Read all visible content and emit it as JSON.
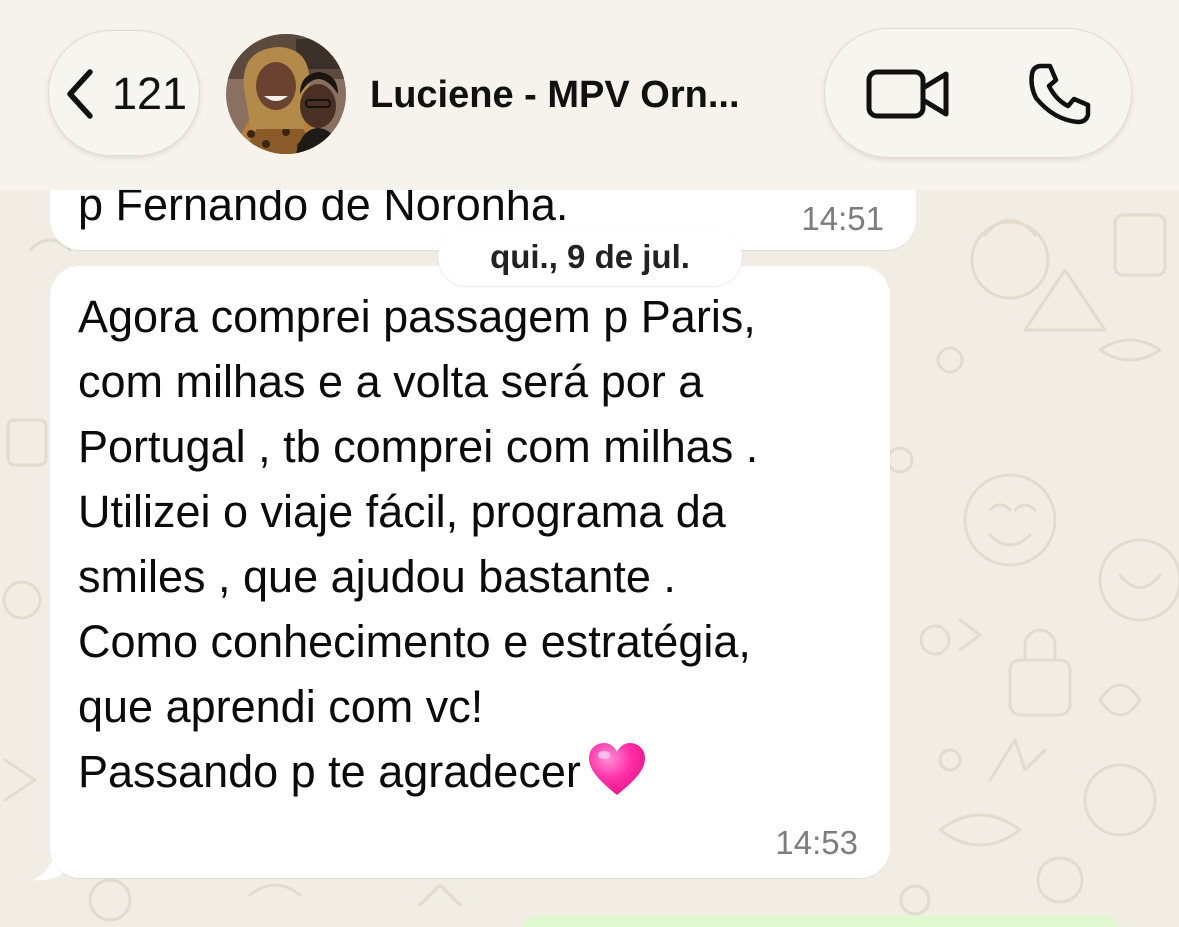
{
  "header": {
    "back_count": "121",
    "contact_name": "Luciene - MPV Orn..."
  },
  "icons": {
    "back": "chevron-left-icon",
    "video": "video-camera-icon",
    "phone": "phone-icon",
    "heart": "pink-heart-emoji"
  },
  "messages": {
    "previous": {
      "text": "p Fernando de Noronha.",
      "time": "14:51"
    },
    "date_separator": "qui., 9 de jul.",
    "main": {
      "lines": [
        "Agora comprei passagem p Paris,",
        "com milhas e a volta será por a",
        "Portugal , tb comprei com milhas .",
        "Utilizei o viaje fácil, programa da",
        "smiles , que ajudou bastante .",
        "Como conhecimento e estratégia,",
        "que aprendi com vc!",
        "Passando p te agradecer"
      ],
      "time": "14:53"
    }
  },
  "colors": {
    "chat_background": "#f2ede4",
    "bubble_incoming": "#ffffff",
    "bubble_outgoing": "#dff8cf",
    "timestamp": "#7d7d7d",
    "heart": "#ff2fa8"
  }
}
